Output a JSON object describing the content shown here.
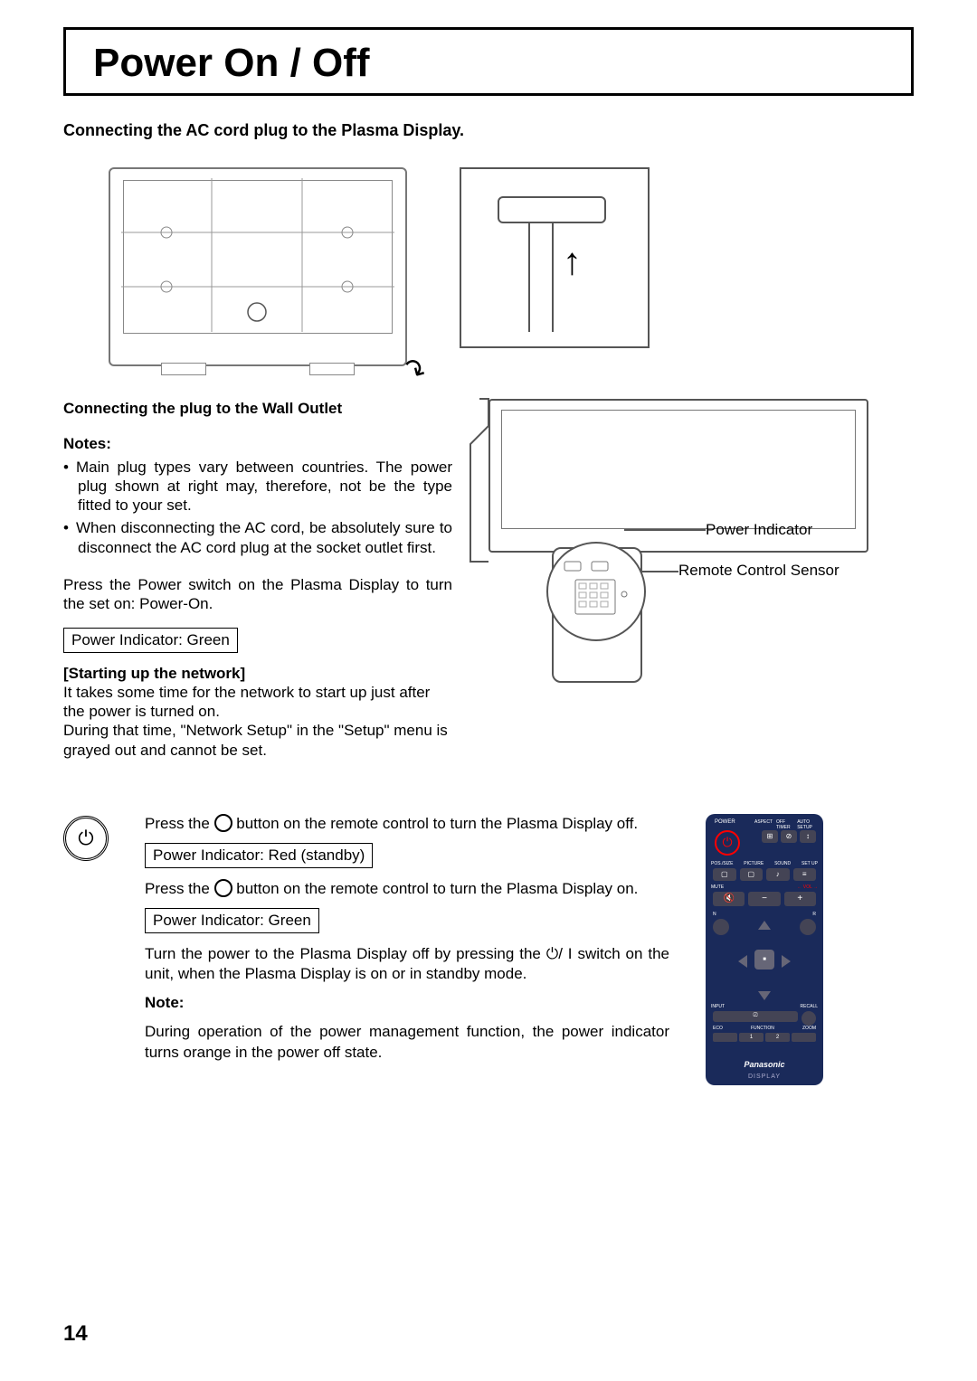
{
  "title": "Power On / Off",
  "subtitle": "Connecting the AC cord plug to the Plasma Display.",
  "left": {
    "h2": "Connecting the plug to the Wall Outlet",
    "notes_h": "Notes:",
    "note1": "Main plug types vary between countries. The power plug shown at right may, therefore, not be the type fitted to your set.",
    "note2": "When disconnecting the AC cord, be absolutely sure to disconnect the AC cord plug at the socket outlet first.",
    "press_power": "Press the Power switch on the Plasma Display to turn the set on: Power-On.",
    "pi_green": "Power Indicator: Green",
    "startup_h": "[Starting up the network]",
    "startup_p1": "It takes some time for the network to start up just after the power is turned on.",
    "startup_p2": "During that time, \"Network Setup\" in the \"Setup\" menu is grayed out and cannot be set."
  },
  "labels": {
    "power_indicator": "Power Indicator",
    "remote_sensor": "Remote Control Sensor"
  },
  "lower": {
    "p1a": "Press the ",
    "p1b": " button on the remote control to turn the Plasma Display off.",
    "pi_red": "Power Indicator: Red (standby)",
    "p2a": "Press the ",
    "p2b": " button on the remote control to turn the Plasma Display on.",
    "pi_green2": "Power Indicator: Green",
    "p3a": "Turn the power to the Plasma Display off by pressing the ",
    "p3_switch": "⏻/ I",
    "p3b": " switch on the unit, when the Plasma Display is on or in standby mode.",
    "note_h": "Note:",
    "note_p": "During operation of the power management function, the power indicator turns orange in the power off state."
  },
  "remote": {
    "power": "POWER",
    "aspect": "ASPECT",
    "offtimer": "OFF TIMER",
    "autosetup": "AUTO SETUP",
    "possize": "POS./SIZE",
    "picture": "PICTURE",
    "sound": "SOUND",
    "setup": "SET UP",
    "mute": "MUTE",
    "vol": "VOL",
    "n": "N",
    "r": "R",
    "input": "INPUT",
    "recall": "RECALL",
    "eco": "ECO",
    "function": "FUNCTION",
    "zoom": "ZOOM",
    "b1": "1",
    "b2": "2",
    "brand": "Panasonic",
    "sub": "DISPLAY"
  },
  "page": "14"
}
